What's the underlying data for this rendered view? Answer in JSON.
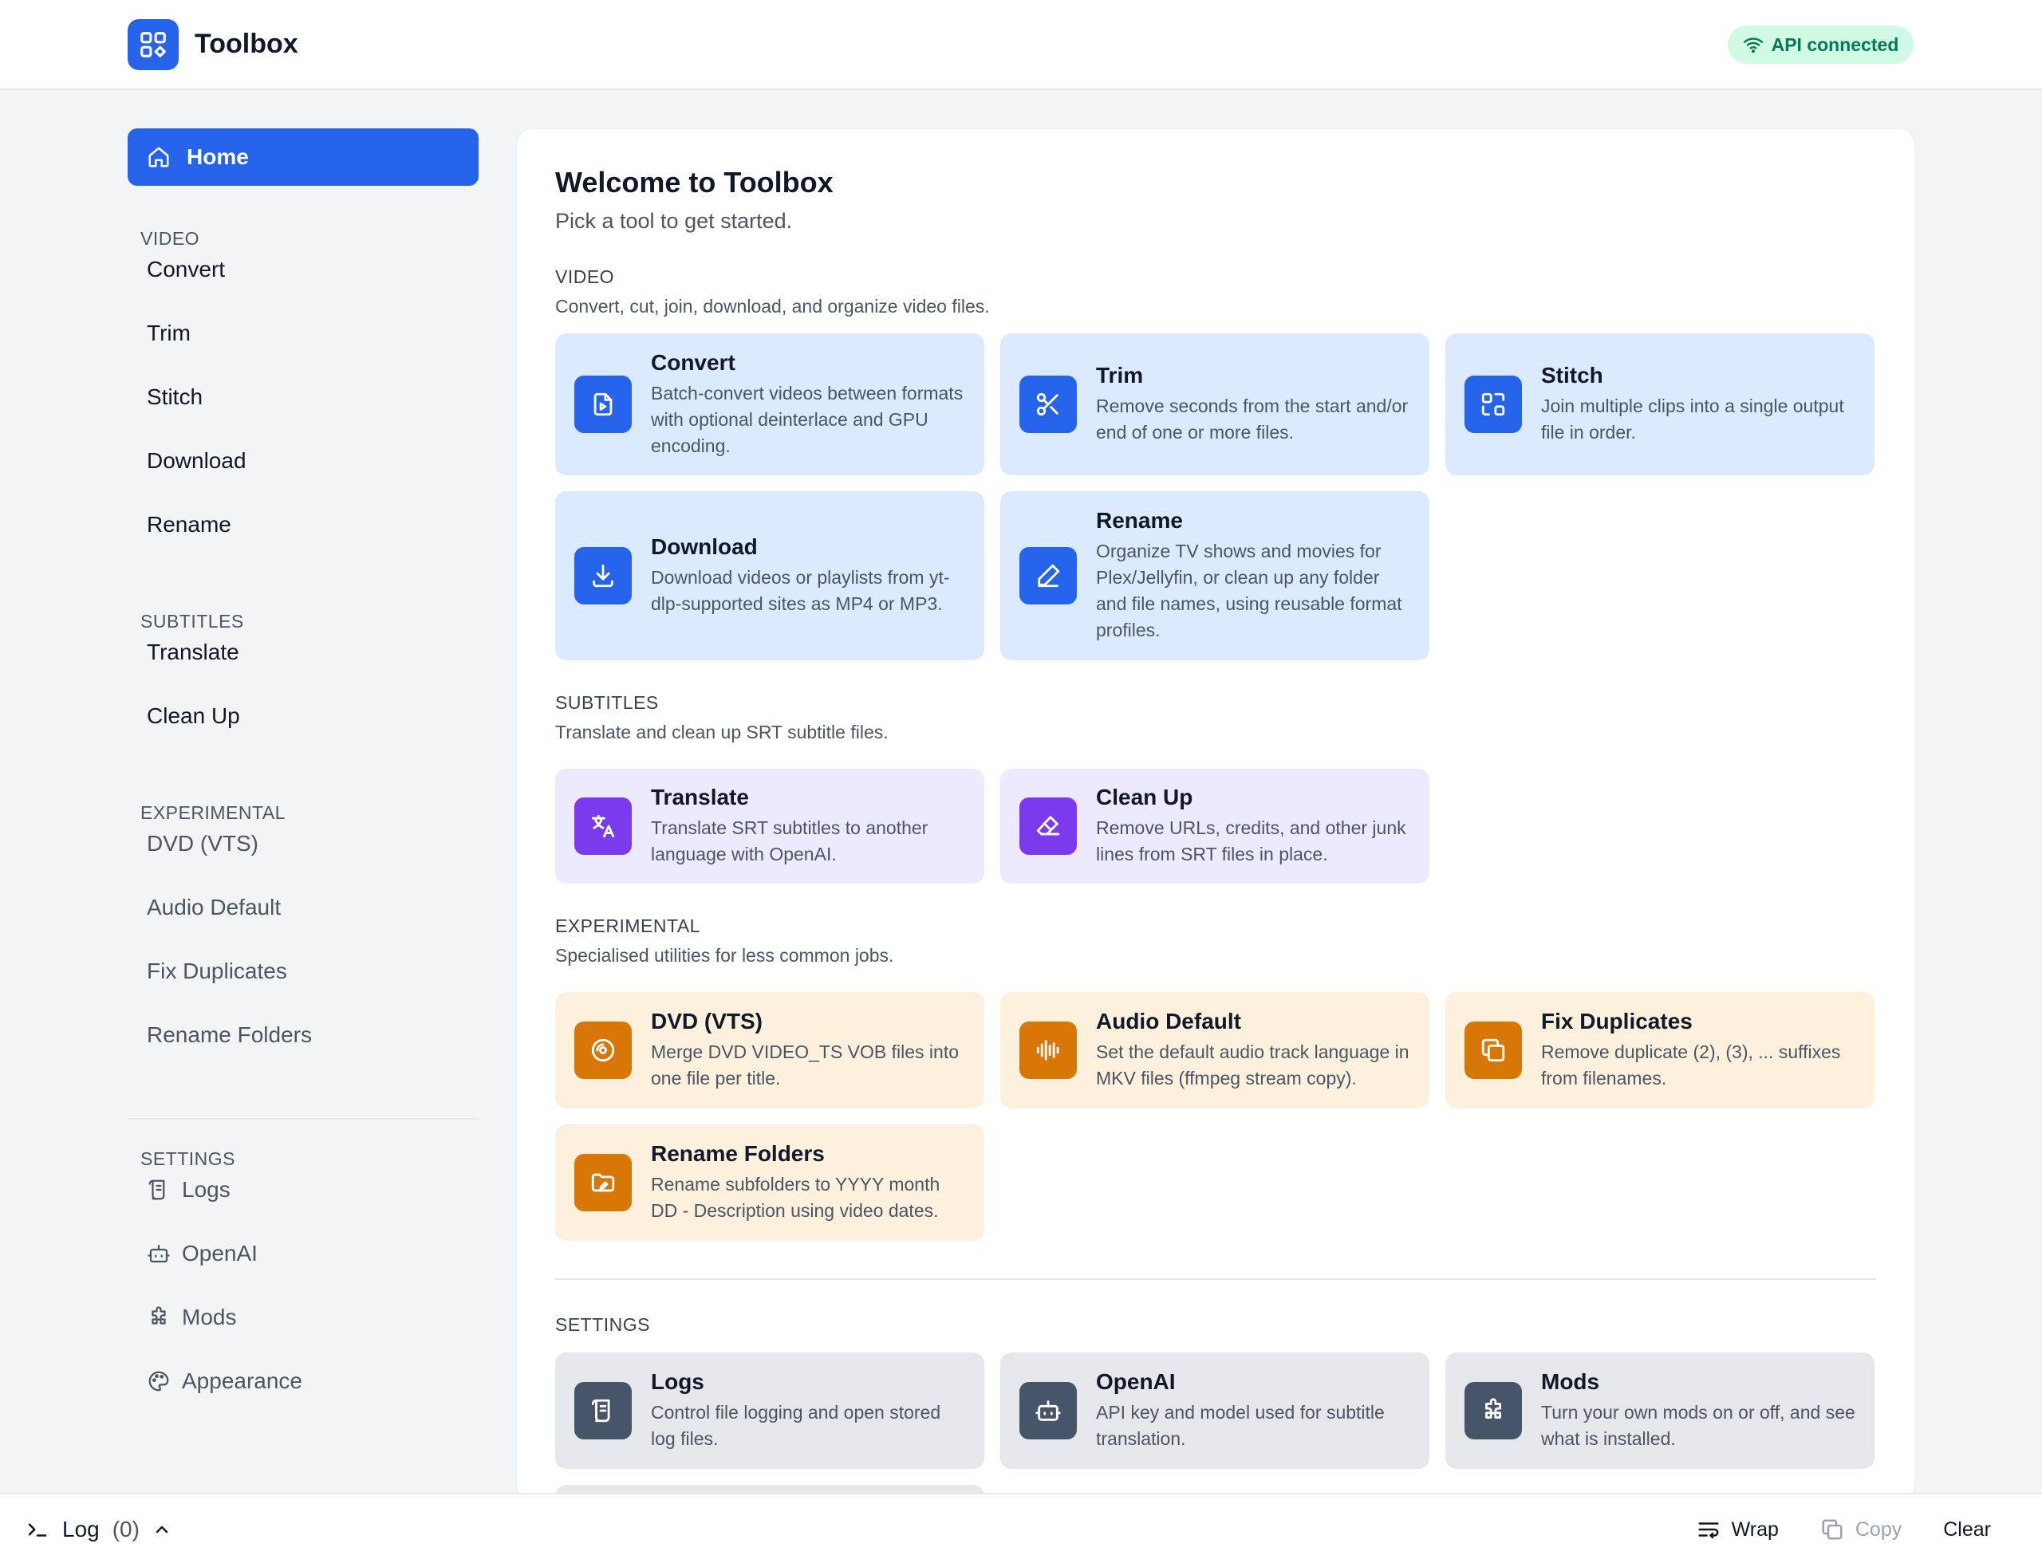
{
  "app": {
    "title": "Toolbox",
    "status": "API connected",
    "colors": {
      "accent": "#2563eb",
      "status": "#047857"
    }
  },
  "sidebar": {
    "home_label": "Home",
    "sections": [
      {
        "title": "VIDEO",
        "items": [
          "Convert",
          "Trim",
          "Stitch",
          "Download",
          "Rename"
        ]
      },
      {
        "title": "SUBTITLES",
        "items": [
          "Translate",
          "Clean Up"
        ]
      },
      {
        "title": "EXPERIMENTAL",
        "items": [
          "DVD (VTS)",
          "Audio Default",
          "Fix Duplicates",
          "Rename Folders"
        ]
      },
      {
        "title": "SETTINGS",
        "items": [
          {
            "label": "Logs",
            "icon": "logs-icon"
          },
          {
            "label": "OpenAI",
            "icon": "robot-icon"
          },
          {
            "label": "Mods",
            "icon": "puzzle-icon"
          },
          {
            "label": "Appearance",
            "icon": "palette-icon"
          }
        ]
      }
    ]
  },
  "main": {
    "title": "Welcome to Toolbox",
    "subtitle": "Pick a tool to get started.",
    "sections": [
      {
        "title": "VIDEO",
        "description": "Convert, cut, join, download, and organize video files.",
        "tools": [
          {
            "name": "Convert",
            "description": "Batch-convert videos between formats with optional deinterlace and GPU encoding.",
            "icon": "file-video-icon"
          },
          {
            "name": "Trim",
            "description": "Remove seconds from the start and/or end of one or more files.",
            "icon": "scissors-icon"
          },
          {
            "name": "Stitch",
            "description": "Join multiple clips into a single output file in order.",
            "icon": "stitch-icon"
          },
          {
            "name": "Download",
            "description": "Download videos or playlists from yt-dlp-supported sites as MP4 or MP3.",
            "icon": "download-icon"
          },
          {
            "name": "Rename",
            "description": "Organize TV shows and movies for Plex/Jellyfin, or clean up any folder and file names, using reusable format profiles.",
            "icon": "pencil-icon"
          }
        ]
      },
      {
        "title": "SUBTITLES",
        "description": "Translate and clean up SRT subtitle files.",
        "tools": [
          {
            "name": "Translate",
            "description": "Translate SRT subtitles to another language with OpenAI.",
            "icon": "translate-icon"
          },
          {
            "name": "Clean Up",
            "description": "Remove URLs, credits, and other junk lines from SRT files in place.",
            "icon": "eraser-icon"
          }
        ]
      },
      {
        "title": "EXPERIMENTAL",
        "description": "Specialised utilities for less common jobs.",
        "tools": [
          {
            "name": "DVD (VTS)",
            "description": "Merge DVD VIDEO_TS VOB files into one file per title.",
            "icon": "disc-icon"
          },
          {
            "name": "Audio Default",
            "description": "Set the default audio track language in MKV files (ffmpeg stream copy).",
            "icon": "audio-wave-icon"
          },
          {
            "name": "Fix Duplicates",
            "description": "Remove duplicate (2), (3), ... suffixes from filenames.",
            "icon": "copy-icon"
          },
          {
            "name": "Rename Folders",
            "description": "Rename subfolders to YYYY month DD - Description using video dates.",
            "icon": "folder-edit-icon"
          }
        ]
      },
      {
        "title": "SETTINGS",
        "tools": [
          {
            "name": "Logs",
            "description": "Control file logging and open stored log files.",
            "icon": "logs-icon"
          },
          {
            "name": "OpenAI",
            "description": "API key and model used for subtitle translation.",
            "icon": "robot-icon"
          },
          {
            "name": "Mods",
            "description": "Turn your own mods on or off, and see what is installed.",
            "icon": "puzzle-icon"
          }
        ]
      }
    ]
  },
  "logbar": {
    "label": "Log",
    "count": "(0)",
    "wrap_label": "Wrap",
    "copy_label": "Copy",
    "clear_label": "Clear"
  }
}
